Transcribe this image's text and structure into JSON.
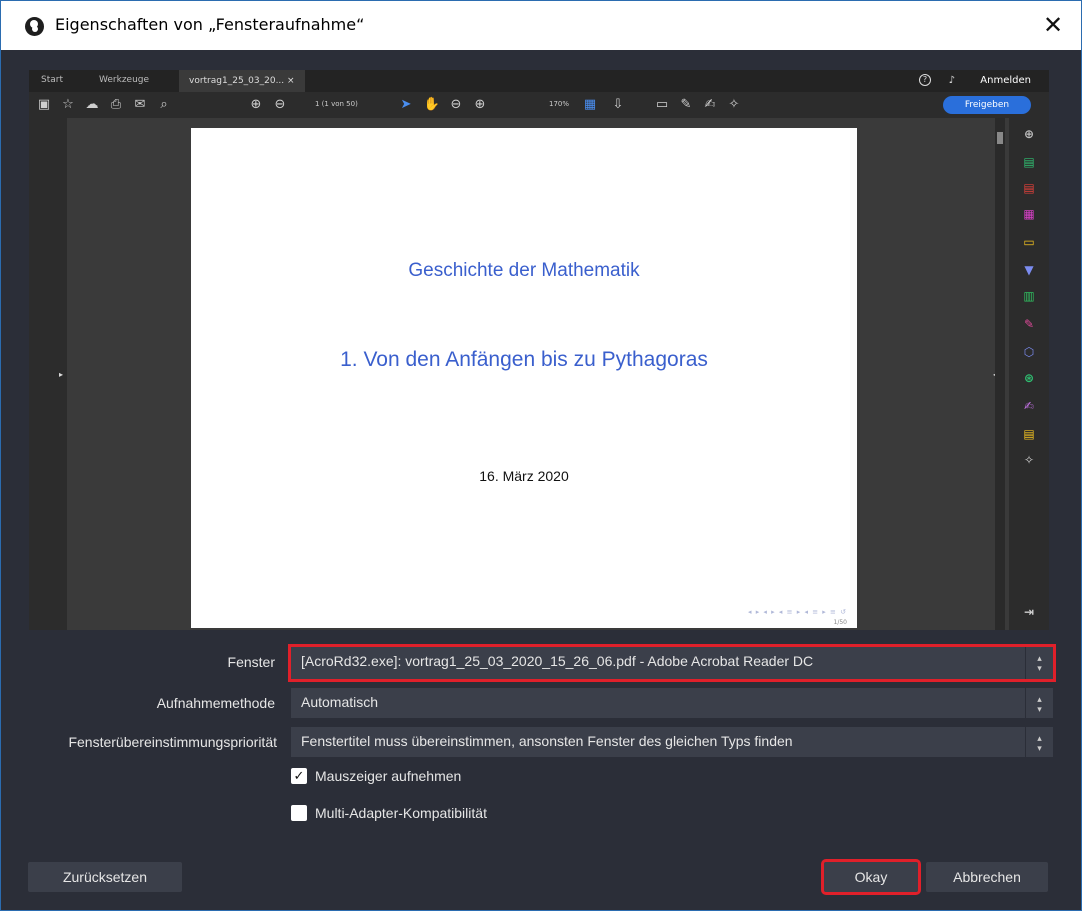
{
  "window": {
    "title": "Eigenschaften von „Fensteraufnahme“",
    "close_glyph": "✕"
  },
  "preview": {
    "tabs": [
      "Start",
      "Werkzeuge",
      "vortrag1_25_03_20..."
    ],
    "tab_close": "×",
    "account_label": "Anmelden",
    "help_glyph": "?",
    "share_label": "Freigeben",
    "page_indicator": "1 (1 von 50)",
    "zoom_value": "170%",
    "document": {
      "title": "Geschichte der Mathematik",
      "subtitle": "1. Von den Anfängen bis zu Pythagoras",
      "date": "16. März 2020",
      "page_number": "1/50"
    },
    "right_tools": [
      {
        "icon": "zoom-icon",
        "color": "#bdbdbd"
      },
      {
        "icon": "export-pdf-icon",
        "color": "#2fbf71"
      },
      {
        "icon": "create-pdf-icon",
        "color": "#e0403a"
      },
      {
        "icon": "organize-pages-icon",
        "color": "#d940c8"
      },
      {
        "icon": "comment-icon",
        "color": "#f0c020"
      },
      {
        "icon": "send-icon",
        "color": "#7b8cf0"
      },
      {
        "icon": "edit-pdf-icon",
        "color": "#30c060"
      },
      {
        "icon": "fill-sign-icon",
        "color": "#e04a9a"
      },
      {
        "icon": "protect-icon",
        "color": "#7b8cf0"
      },
      {
        "icon": "optimize-icon",
        "color": "#2fbf71"
      },
      {
        "icon": "sign-icon",
        "color": "#c070e0"
      },
      {
        "icon": "more-tools-icon",
        "color": "#f0c020"
      },
      {
        "icon": "certificates-icon",
        "color": "#d0d0d0"
      }
    ]
  },
  "form": {
    "window_label": "Fenster",
    "window_value": "[AcroRd32.exe]: vortrag1_25_03_2020_15_26_06.pdf - Adobe Acrobat Reader DC",
    "method_label": "Aufnahmemethode",
    "method_value": "Automatisch",
    "priority_label": "Fensterübereinstimmungspriorität",
    "priority_value": "Fenstertitel muss übereinstimmen, ansonsten Fenster des gleichen Typs finden",
    "capture_cursor_label": "Mauszeiger aufnehmen",
    "capture_cursor_checked": true,
    "multi_adapter_label": "Multi-Adapter-Kompatibilität",
    "multi_adapter_checked": false,
    "check_glyph": "✓",
    "spin_up": "▴",
    "spin_down": "▾"
  },
  "buttons": {
    "reset": "Zurücksetzen",
    "ok": "Okay",
    "cancel": "Abbrechen"
  },
  "colors": {
    "highlight": "#e0202a",
    "dialog_bg": "#2b2e38",
    "control_bg": "#3b3f4a",
    "doc_heading": "#3a5fcd"
  }
}
